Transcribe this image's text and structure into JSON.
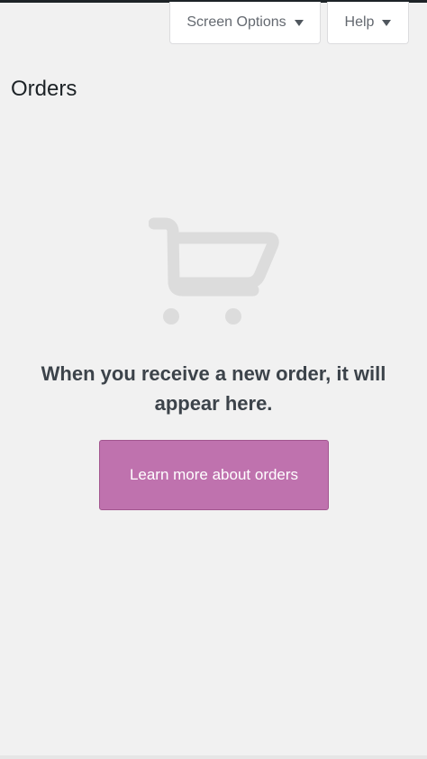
{
  "header": {
    "screen_options_label": "Screen Options",
    "help_label": "Help"
  },
  "page": {
    "title": "Orders"
  },
  "empty_state": {
    "icon": "shopping-cart-icon",
    "message": "When you receive a new order, it will appear here.",
    "button_label": "Learn more about orders"
  },
  "colors": {
    "background": "#f1f1f1",
    "accent": "#bf72ae",
    "icon": "#dcdcdc",
    "text": "#3c434a"
  }
}
